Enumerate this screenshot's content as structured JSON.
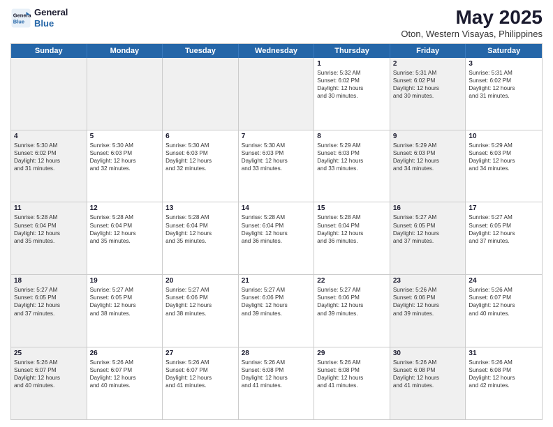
{
  "header": {
    "logo_line1": "General",
    "logo_line2": "Blue",
    "month_title": "May 2025",
    "location": "Oton, Western Visayas, Philippines"
  },
  "days_of_week": [
    "Sunday",
    "Monday",
    "Tuesday",
    "Wednesday",
    "Thursday",
    "Friday",
    "Saturday"
  ],
  "weeks": [
    [
      {
        "day": "",
        "info": "",
        "shaded": true
      },
      {
        "day": "",
        "info": "",
        "shaded": true
      },
      {
        "day": "",
        "info": "",
        "shaded": true
      },
      {
        "day": "",
        "info": "",
        "shaded": true
      },
      {
        "day": "1",
        "info": "Sunrise: 5:32 AM\nSunset: 6:02 PM\nDaylight: 12 hours\nand 30 minutes.",
        "shaded": false
      },
      {
        "day": "2",
        "info": "Sunrise: 5:31 AM\nSunset: 6:02 PM\nDaylight: 12 hours\nand 30 minutes.",
        "shaded": true
      },
      {
        "day": "3",
        "info": "Sunrise: 5:31 AM\nSunset: 6:02 PM\nDaylight: 12 hours\nand 31 minutes.",
        "shaded": false
      }
    ],
    [
      {
        "day": "4",
        "info": "Sunrise: 5:30 AM\nSunset: 6:02 PM\nDaylight: 12 hours\nand 31 minutes.",
        "shaded": true
      },
      {
        "day": "5",
        "info": "Sunrise: 5:30 AM\nSunset: 6:03 PM\nDaylight: 12 hours\nand 32 minutes.",
        "shaded": false
      },
      {
        "day": "6",
        "info": "Sunrise: 5:30 AM\nSunset: 6:03 PM\nDaylight: 12 hours\nand 32 minutes.",
        "shaded": false
      },
      {
        "day": "7",
        "info": "Sunrise: 5:30 AM\nSunset: 6:03 PM\nDaylight: 12 hours\nand 33 minutes.",
        "shaded": false
      },
      {
        "day": "8",
        "info": "Sunrise: 5:29 AM\nSunset: 6:03 PM\nDaylight: 12 hours\nand 33 minutes.",
        "shaded": false
      },
      {
        "day": "9",
        "info": "Sunrise: 5:29 AM\nSunset: 6:03 PM\nDaylight: 12 hours\nand 34 minutes.",
        "shaded": true
      },
      {
        "day": "10",
        "info": "Sunrise: 5:29 AM\nSunset: 6:03 PM\nDaylight: 12 hours\nand 34 minutes.",
        "shaded": false
      }
    ],
    [
      {
        "day": "11",
        "info": "Sunrise: 5:28 AM\nSunset: 6:04 PM\nDaylight: 12 hours\nand 35 minutes.",
        "shaded": true
      },
      {
        "day": "12",
        "info": "Sunrise: 5:28 AM\nSunset: 6:04 PM\nDaylight: 12 hours\nand 35 minutes.",
        "shaded": false
      },
      {
        "day": "13",
        "info": "Sunrise: 5:28 AM\nSunset: 6:04 PM\nDaylight: 12 hours\nand 35 minutes.",
        "shaded": false
      },
      {
        "day": "14",
        "info": "Sunrise: 5:28 AM\nSunset: 6:04 PM\nDaylight: 12 hours\nand 36 minutes.",
        "shaded": false
      },
      {
        "day": "15",
        "info": "Sunrise: 5:28 AM\nSunset: 6:04 PM\nDaylight: 12 hours\nand 36 minutes.",
        "shaded": false
      },
      {
        "day": "16",
        "info": "Sunrise: 5:27 AM\nSunset: 6:05 PM\nDaylight: 12 hours\nand 37 minutes.",
        "shaded": true
      },
      {
        "day": "17",
        "info": "Sunrise: 5:27 AM\nSunset: 6:05 PM\nDaylight: 12 hours\nand 37 minutes.",
        "shaded": false
      }
    ],
    [
      {
        "day": "18",
        "info": "Sunrise: 5:27 AM\nSunset: 6:05 PM\nDaylight: 12 hours\nand 37 minutes.",
        "shaded": true
      },
      {
        "day": "19",
        "info": "Sunrise: 5:27 AM\nSunset: 6:05 PM\nDaylight: 12 hours\nand 38 minutes.",
        "shaded": false
      },
      {
        "day": "20",
        "info": "Sunrise: 5:27 AM\nSunset: 6:06 PM\nDaylight: 12 hours\nand 38 minutes.",
        "shaded": false
      },
      {
        "day": "21",
        "info": "Sunrise: 5:27 AM\nSunset: 6:06 PM\nDaylight: 12 hours\nand 39 minutes.",
        "shaded": false
      },
      {
        "day": "22",
        "info": "Sunrise: 5:27 AM\nSunset: 6:06 PM\nDaylight: 12 hours\nand 39 minutes.",
        "shaded": false
      },
      {
        "day": "23",
        "info": "Sunrise: 5:26 AM\nSunset: 6:06 PM\nDaylight: 12 hours\nand 39 minutes.",
        "shaded": true
      },
      {
        "day": "24",
        "info": "Sunrise: 5:26 AM\nSunset: 6:07 PM\nDaylight: 12 hours\nand 40 minutes.",
        "shaded": false
      }
    ],
    [
      {
        "day": "25",
        "info": "Sunrise: 5:26 AM\nSunset: 6:07 PM\nDaylight: 12 hours\nand 40 minutes.",
        "shaded": true
      },
      {
        "day": "26",
        "info": "Sunrise: 5:26 AM\nSunset: 6:07 PM\nDaylight: 12 hours\nand 40 minutes.",
        "shaded": false
      },
      {
        "day": "27",
        "info": "Sunrise: 5:26 AM\nSunset: 6:07 PM\nDaylight: 12 hours\nand 41 minutes.",
        "shaded": false
      },
      {
        "day": "28",
        "info": "Sunrise: 5:26 AM\nSunset: 6:08 PM\nDaylight: 12 hours\nand 41 minutes.",
        "shaded": false
      },
      {
        "day": "29",
        "info": "Sunrise: 5:26 AM\nSunset: 6:08 PM\nDaylight: 12 hours\nand 41 minutes.",
        "shaded": false
      },
      {
        "day": "30",
        "info": "Sunrise: 5:26 AM\nSunset: 6:08 PM\nDaylight: 12 hours\nand 41 minutes.",
        "shaded": true
      },
      {
        "day": "31",
        "info": "Sunrise: 5:26 AM\nSunset: 6:08 PM\nDaylight: 12 hours\nand 42 minutes.",
        "shaded": false
      }
    ]
  ]
}
